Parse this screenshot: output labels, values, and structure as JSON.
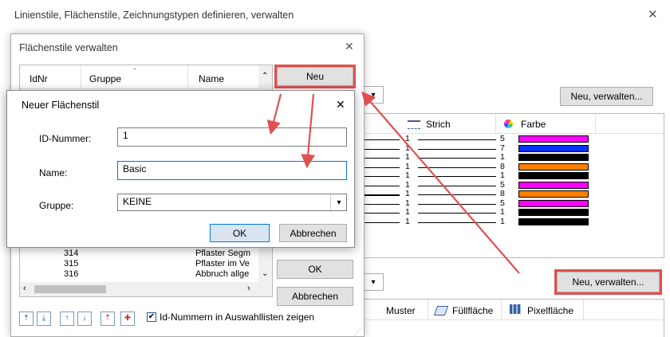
{
  "main_window": {
    "title": "Linienstile, Flächenstile, Zeichnungstypen definieren, verwalten",
    "close_glyph": "✕",
    "neu_verwalten_top": "Neu, verwalten...",
    "neu_verwalten_bottom": "Neu, verwalten...",
    "dropdown_glyph": "▾",
    "line_table": {
      "col_strich": "Strich",
      "col_farbe": "Farbe",
      "rows": [
        {
          "a": "1",
          "b": "5",
          "color": "#ff00ff"
        },
        {
          "a": "1",
          "b": "7",
          "color": "#0033ff"
        },
        {
          "a": "1",
          "b": "1",
          "color": "#000000"
        },
        {
          "a": "1",
          "b": "8",
          "color": "#ff8000"
        },
        {
          "a": "1",
          "b": "1",
          "color": "#000000"
        },
        {
          "a": "1",
          "b": "5",
          "color": "#ff00ff"
        },
        {
          "a": "1",
          "b": "8",
          "color": "#ff8000"
        },
        {
          "a": "1",
          "b": "5",
          "color": "#ff00ff"
        },
        {
          "a": "1",
          "b": "1",
          "color": "#000000"
        },
        {
          "a": "1",
          "b": "1",
          "color": "#000000"
        }
      ]
    },
    "bottom_table": {
      "col_muster": "Muster",
      "col_fuellflaeche": "Füllfläche",
      "col_pixelflaeche": "Pixelfläche"
    }
  },
  "flaechenstile_dialog": {
    "title": "Flächenstile verwalten",
    "close_glyph": "✕",
    "col_idnr": "IdNr",
    "col_gruppe": "Gruppe",
    "col_name": "Name",
    "neu_label": "Neu",
    "ok_label": "OK",
    "abbrechen_label": "Abbrechen",
    "rows": [
      {
        "id": "314",
        "name": "Pflaster Segm"
      },
      {
        "id": "315",
        "name": "Pflaster im Ve"
      },
      {
        "id": "316",
        "name": "Abbruch allge"
      }
    ],
    "checkbox_label": "Id-Nummern in Auswahllisten zeigen",
    "checkbox_checked": true
  },
  "neuer_dialog": {
    "title": "Neuer Flächenstil",
    "close_glyph": "✕",
    "id_label": "ID-Nummer:",
    "id_value": "1",
    "name_label": "Name:",
    "name_value": "Basic",
    "gruppe_label": "Gruppe:",
    "gruppe_value": "KEINE",
    "ok_label": "OK",
    "abbrechen_label": "Abbrechen"
  },
  "colors": {
    "annotation_red": "#e05050",
    "selection_blue": "#cce4f7"
  }
}
